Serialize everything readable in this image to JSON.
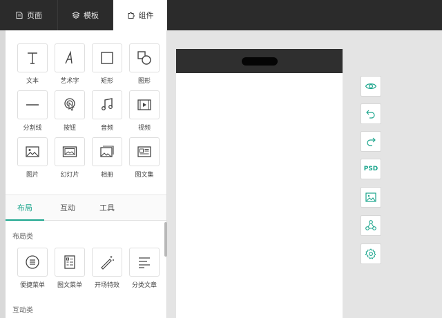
{
  "nav": {
    "tabs": [
      {
        "label": "页面",
        "icon": "page-icon"
      },
      {
        "label": "模板",
        "icon": "layers-icon"
      },
      {
        "label": "组件",
        "icon": "puzzle-icon"
      }
    ],
    "active_tab": "组件"
  },
  "components": [
    {
      "label": "文本",
      "icon": "text-icon"
    },
    {
      "label": "艺术字",
      "icon": "art-text-icon"
    },
    {
      "label": "矩形",
      "icon": "rectangle-icon"
    },
    {
      "label": "图形",
      "icon": "shapes-icon"
    },
    {
      "label": "分割线",
      "icon": "divider-line-icon"
    },
    {
      "label": "按钮",
      "icon": "button-tap-icon"
    },
    {
      "label": "音频",
      "icon": "music-icon"
    },
    {
      "label": "视频",
      "icon": "video-icon"
    },
    {
      "label": "图片",
      "icon": "image-icon"
    },
    {
      "label": "幻灯片",
      "icon": "slideshow-icon"
    },
    {
      "label": "相册",
      "icon": "album-icon"
    },
    {
      "label": "图文集",
      "icon": "article-collection-icon"
    }
  ],
  "subtabs": [
    {
      "label": "布局"
    },
    {
      "label": "互动"
    },
    {
      "label": "工具"
    }
  ],
  "active_subtab": "布局",
  "layout_section": {
    "title": "布局类",
    "items": [
      {
        "label": "便捷菜单",
        "icon": "menu-list-icon"
      },
      {
        "label": "图文菜单",
        "icon": "grid-menu-icon"
      },
      {
        "label": "开场特效",
        "icon": "magic-wand-icon"
      },
      {
        "label": "分类文章",
        "icon": "category-list-icon"
      }
    ]
  },
  "interaction_section": {
    "title": "互动类"
  },
  "tools": [
    {
      "name": "preview",
      "icon": "eye-icon"
    },
    {
      "name": "undo",
      "icon": "undo-icon"
    },
    {
      "name": "redo",
      "icon": "redo-icon"
    },
    {
      "name": "psd",
      "label": "PSD"
    },
    {
      "name": "background-image",
      "icon": "image-icon"
    },
    {
      "name": "share",
      "icon": "share-icon"
    },
    {
      "name": "settings",
      "icon": "gear-icon"
    }
  ],
  "colors": {
    "accent": "#1aa58c",
    "topbar": "#2b2b2b",
    "canvas_bg": "#e4e4e4"
  }
}
